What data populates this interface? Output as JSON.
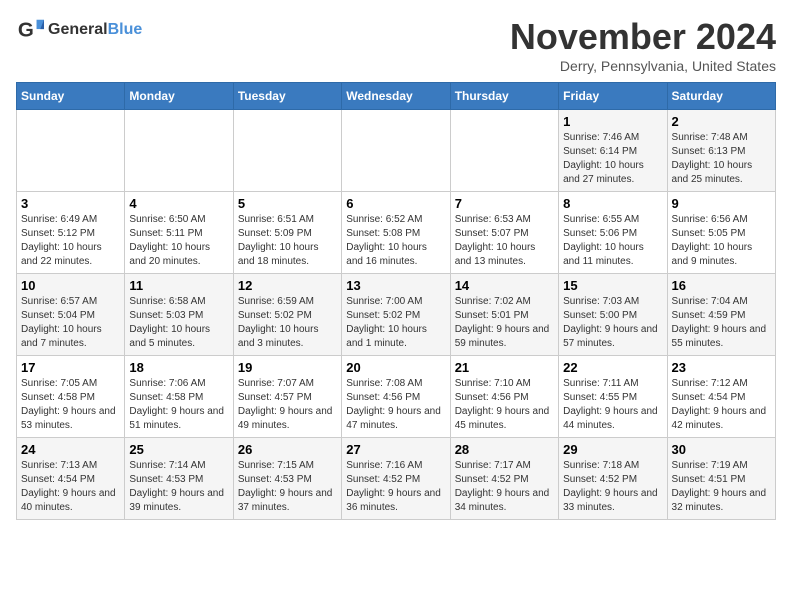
{
  "header": {
    "logo_general": "General",
    "logo_blue": "Blue",
    "month_title": "November 2024",
    "location": "Derry, Pennsylvania, United States"
  },
  "weekdays": [
    "Sunday",
    "Monday",
    "Tuesday",
    "Wednesday",
    "Thursday",
    "Friday",
    "Saturday"
  ],
  "weeks": [
    [
      {
        "day": "",
        "info": ""
      },
      {
        "day": "",
        "info": ""
      },
      {
        "day": "",
        "info": ""
      },
      {
        "day": "",
        "info": ""
      },
      {
        "day": "",
        "info": ""
      },
      {
        "day": "1",
        "info": "Sunrise: 7:46 AM\nSunset: 6:14 PM\nDaylight: 10 hours and 27 minutes."
      },
      {
        "day": "2",
        "info": "Sunrise: 7:48 AM\nSunset: 6:13 PM\nDaylight: 10 hours and 25 minutes."
      }
    ],
    [
      {
        "day": "3",
        "info": "Sunrise: 6:49 AM\nSunset: 5:12 PM\nDaylight: 10 hours and 22 minutes."
      },
      {
        "day": "4",
        "info": "Sunrise: 6:50 AM\nSunset: 5:11 PM\nDaylight: 10 hours and 20 minutes."
      },
      {
        "day": "5",
        "info": "Sunrise: 6:51 AM\nSunset: 5:09 PM\nDaylight: 10 hours and 18 minutes."
      },
      {
        "day": "6",
        "info": "Sunrise: 6:52 AM\nSunset: 5:08 PM\nDaylight: 10 hours and 16 minutes."
      },
      {
        "day": "7",
        "info": "Sunrise: 6:53 AM\nSunset: 5:07 PM\nDaylight: 10 hours and 13 minutes."
      },
      {
        "day": "8",
        "info": "Sunrise: 6:55 AM\nSunset: 5:06 PM\nDaylight: 10 hours and 11 minutes."
      },
      {
        "day": "9",
        "info": "Sunrise: 6:56 AM\nSunset: 5:05 PM\nDaylight: 10 hours and 9 minutes."
      }
    ],
    [
      {
        "day": "10",
        "info": "Sunrise: 6:57 AM\nSunset: 5:04 PM\nDaylight: 10 hours and 7 minutes."
      },
      {
        "day": "11",
        "info": "Sunrise: 6:58 AM\nSunset: 5:03 PM\nDaylight: 10 hours and 5 minutes."
      },
      {
        "day": "12",
        "info": "Sunrise: 6:59 AM\nSunset: 5:02 PM\nDaylight: 10 hours and 3 minutes."
      },
      {
        "day": "13",
        "info": "Sunrise: 7:00 AM\nSunset: 5:02 PM\nDaylight: 10 hours and 1 minute."
      },
      {
        "day": "14",
        "info": "Sunrise: 7:02 AM\nSunset: 5:01 PM\nDaylight: 9 hours and 59 minutes."
      },
      {
        "day": "15",
        "info": "Sunrise: 7:03 AM\nSunset: 5:00 PM\nDaylight: 9 hours and 57 minutes."
      },
      {
        "day": "16",
        "info": "Sunrise: 7:04 AM\nSunset: 4:59 PM\nDaylight: 9 hours and 55 minutes."
      }
    ],
    [
      {
        "day": "17",
        "info": "Sunrise: 7:05 AM\nSunset: 4:58 PM\nDaylight: 9 hours and 53 minutes."
      },
      {
        "day": "18",
        "info": "Sunrise: 7:06 AM\nSunset: 4:58 PM\nDaylight: 9 hours and 51 minutes."
      },
      {
        "day": "19",
        "info": "Sunrise: 7:07 AM\nSunset: 4:57 PM\nDaylight: 9 hours and 49 minutes."
      },
      {
        "day": "20",
        "info": "Sunrise: 7:08 AM\nSunset: 4:56 PM\nDaylight: 9 hours and 47 minutes."
      },
      {
        "day": "21",
        "info": "Sunrise: 7:10 AM\nSunset: 4:56 PM\nDaylight: 9 hours and 45 minutes."
      },
      {
        "day": "22",
        "info": "Sunrise: 7:11 AM\nSunset: 4:55 PM\nDaylight: 9 hours and 44 minutes."
      },
      {
        "day": "23",
        "info": "Sunrise: 7:12 AM\nSunset: 4:54 PM\nDaylight: 9 hours and 42 minutes."
      }
    ],
    [
      {
        "day": "24",
        "info": "Sunrise: 7:13 AM\nSunset: 4:54 PM\nDaylight: 9 hours and 40 minutes."
      },
      {
        "day": "25",
        "info": "Sunrise: 7:14 AM\nSunset: 4:53 PM\nDaylight: 9 hours and 39 minutes."
      },
      {
        "day": "26",
        "info": "Sunrise: 7:15 AM\nSunset: 4:53 PM\nDaylight: 9 hours and 37 minutes."
      },
      {
        "day": "27",
        "info": "Sunrise: 7:16 AM\nSunset: 4:52 PM\nDaylight: 9 hours and 36 minutes."
      },
      {
        "day": "28",
        "info": "Sunrise: 7:17 AM\nSunset: 4:52 PM\nDaylight: 9 hours and 34 minutes."
      },
      {
        "day": "29",
        "info": "Sunrise: 7:18 AM\nSunset: 4:52 PM\nDaylight: 9 hours and 33 minutes."
      },
      {
        "day": "30",
        "info": "Sunrise: 7:19 AM\nSunset: 4:51 PM\nDaylight: 9 hours and 32 minutes."
      }
    ]
  ]
}
